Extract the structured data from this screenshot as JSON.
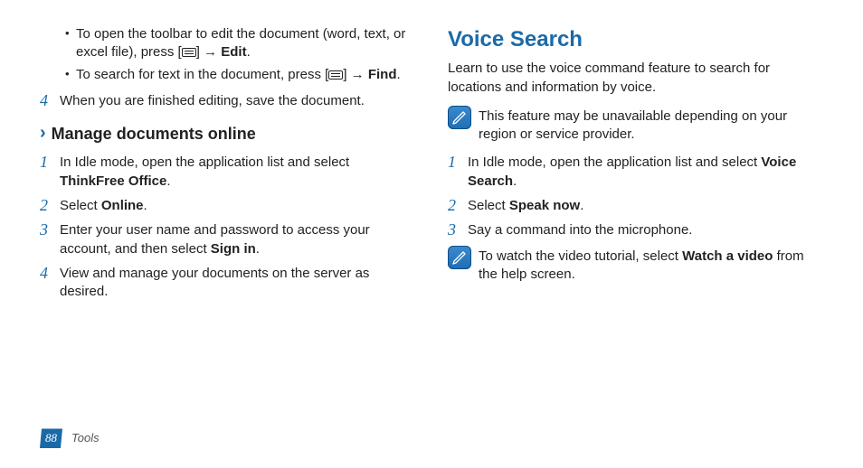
{
  "left": {
    "bullets": [
      {
        "pre": "To open the toolbar to edit the document (word, text, or excel file), press [",
        "post": "] → ",
        "bold": "Edit",
        "tail": "."
      },
      {
        "pre": "To search for text in the document, press [",
        "post": "] → ",
        "bold": "Find",
        "tail": "."
      }
    ],
    "step4": "When you are finished editing, save the document.",
    "subhead": "Manage documents online",
    "steps": [
      {
        "n": "1",
        "pre": "In Idle mode, open the application list and select ",
        "bold": "ThinkFree Office",
        "tail": "."
      },
      {
        "n": "2",
        "pre": "Select ",
        "bold": "Online",
        "tail": "."
      },
      {
        "n": "3",
        "pre": "Enter your user name and password to access your account, and then select ",
        "bold": "Sign in",
        "tail": "."
      },
      {
        "n": "4",
        "pre": "View and manage your documents on the server as desired.",
        "bold": "",
        "tail": ""
      }
    ]
  },
  "right": {
    "title": "Voice Search",
    "intro": "Learn to use the voice command feature to search for locations and information by voice.",
    "note1": "This feature may be unavailable depending on your region or service provider.",
    "steps": [
      {
        "n": "1",
        "pre": "In Idle mode, open the application list and select ",
        "bold": "Voice Search",
        "tail": "."
      },
      {
        "n": "2",
        "pre": "Select ",
        "bold": "Speak now",
        "tail": "."
      },
      {
        "n": "3",
        "pre": "Say a command into the microphone.",
        "bold": "",
        "tail": ""
      }
    ],
    "note2_pre": "To watch the video tutorial, select ",
    "note2_bold": "Watch a video",
    "note2_tail": " from the help screen."
  },
  "footer": {
    "page": "88",
    "section": "Tools"
  }
}
